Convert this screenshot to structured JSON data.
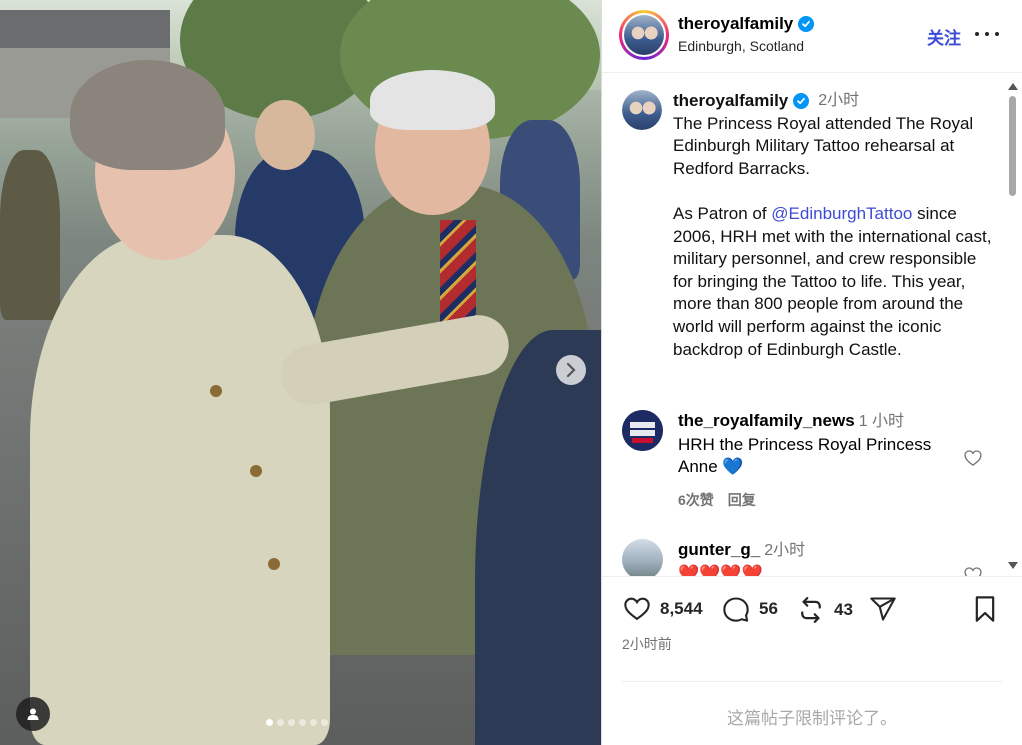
{
  "post": {
    "username": "theroyalfamily",
    "location": "Edinburgh, Scotland",
    "follow_label": "关注",
    "more_label": "More options",
    "caption_time": "2小时",
    "caption_line1": "The Princess Royal attended The Royal Edinburgh Military Tattoo rehearsal at Redford Barracks.",
    "caption_part2_before": "As Patron of ",
    "caption_mention": "@EdinburghTattoo",
    "caption_part2_after": " since 2006, HRH met with the international cast, military personnel, and crew responsible for bringing the Tattoo to life. This year, more than 800 people from around the world will perform against the iconic backdrop of Edinburgh Castle.",
    "likes": "8,544",
    "comments_count": "56",
    "reposts": "43",
    "posted_time": "2小时前",
    "comments_disabled": "这篇帖子限制评论了。"
  },
  "comments": [
    {
      "username": "the_royalfamily_news",
      "time": "1 小时",
      "text": "HRH the Princess Royal Princess Anne 💙",
      "likes_label": "6次赞",
      "reply_label": "回复"
    },
    {
      "username": "gunter_g_",
      "time": "2小时",
      "text": "❤️❤️❤️❤️"
    }
  ],
  "carousel": {
    "slides": 6,
    "active": 1
  }
}
